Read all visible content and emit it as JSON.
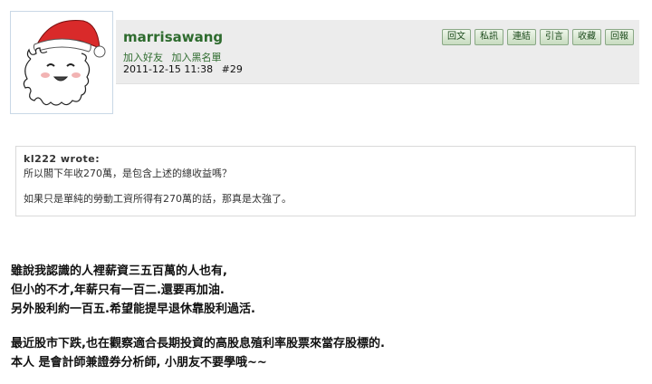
{
  "user": {
    "name": "marrisawang",
    "add_friend": "加入好友",
    "add_blacklist": "加入黑名單"
  },
  "post": {
    "datetime": "2011-12-15 11:38",
    "floor": "#29"
  },
  "actions": [
    "回文",
    "私訊",
    "連結",
    "引言",
    "收藏",
    "回報"
  ],
  "quote": {
    "author": "kl222 wrote:",
    "line1": "所以閣下年收270萬，是包含上述的總收益嗎？",
    "line2": "如果只是單純的勞動工資所得有270萬的話，那真是太強了。"
  },
  "body": {
    "p1": "雖說我認識的人裡薪資三五百萬的人也有,",
    "p2": "但小的不才,年薪只有一百二.還要再加油.",
    "p3": "另外股利約一百五.希望能提早退休靠股利過活.",
    "p4": "最近股市下跌,也在觀察適合長期投資的高股息殖利率股票來當存股標的.",
    "p5": "本人 是會計師兼證券分析師, 小朋友不要學哦~~"
  },
  "avatar": {
    "icon": "santa-hat-fluffy-character"
  },
  "colors": {
    "username": "#2e6b2e",
    "header_bg": "#ececec",
    "button_bg": "#d8e8d0",
    "avatar_border": "#c9d8e6"
  }
}
